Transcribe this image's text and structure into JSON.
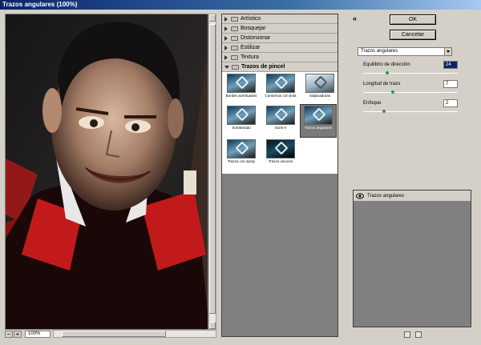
{
  "window": {
    "title": "Trazos angulares (100%)"
  },
  "preview": {
    "zoom": "100%"
  },
  "categories": [
    {
      "label": "Artístico"
    },
    {
      "label": "Bosquejar"
    },
    {
      "label": "Distorsionar"
    },
    {
      "label": "Estilizar"
    },
    {
      "label": "Textura"
    },
    {
      "label": "Trazos de pincel"
    }
  ],
  "filters": [
    {
      "label": "Bordes acentuados"
    },
    {
      "label": "Contornos con tinta"
    },
    {
      "label": "Salpicaduras"
    },
    {
      "label": "Sombreado"
    },
    {
      "label": "Sumi-e"
    },
    {
      "label": "Trazos angulares"
    },
    {
      "label": "Trazos con spray"
    },
    {
      "label": "Trazos oscuros"
    }
  ],
  "buttons": {
    "ok": "OK",
    "cancel": "Cancelar"
  },
  "settings": {
    "filter_select": "Trazos angulares",
    "params": [
      {
        "label": "Equilibrio de dirección",
        "value": "24",
        "level": 0.24
      },
      {
        "label": "Longitud de trazo",
        "value": "7",
        "level": 0.3
      },
      {
        "label": "Enfoque",
        "value": "2",
        "level": 0.2
      }
    ]
  },
  "layers": {
    "item": "Trazos angulares"
  }
}
